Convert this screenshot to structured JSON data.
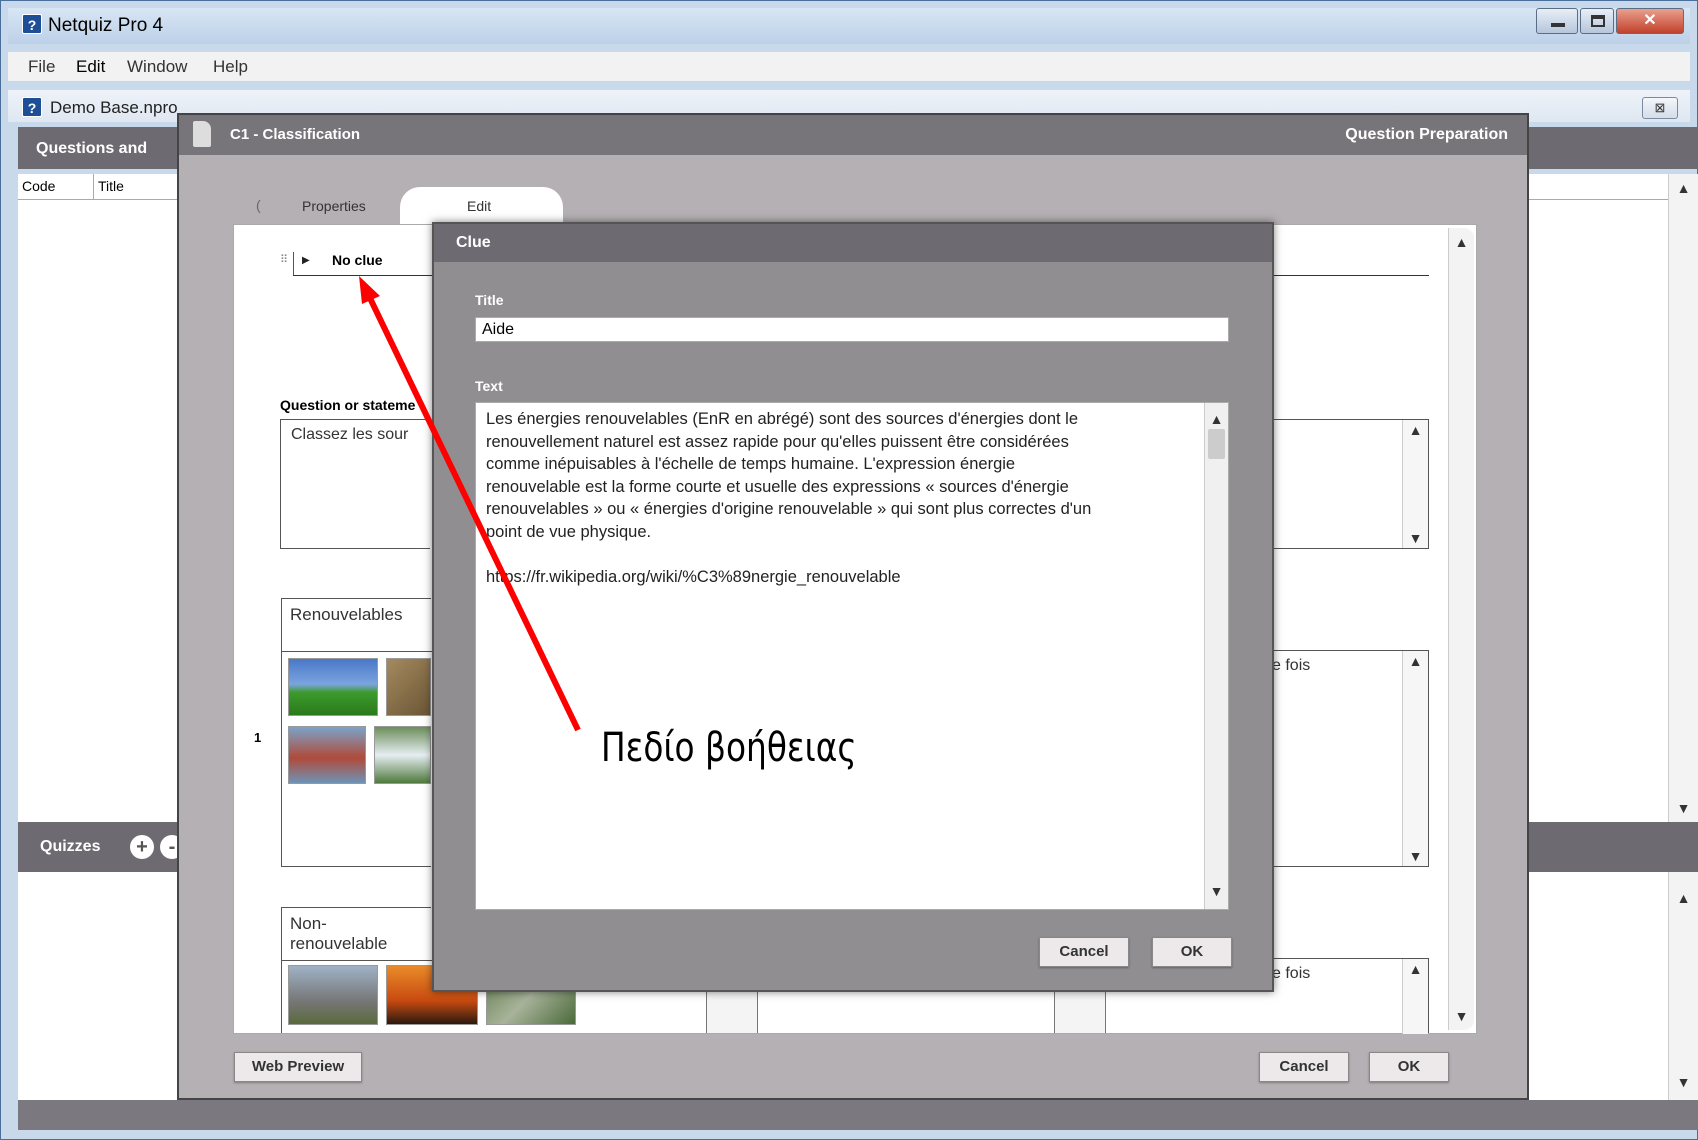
{
  "window": {
    "title": "Netquiz Pro 4",
    "app_icon": "help-icon"
  },
  "menu": [
    "File",
    "Edit",
    "Window",
    "Help"
  ],
  "document": {
    "name": "Demo Base.npro",
    "close_icon": "close-icon"
  },
  "questions_panel": {
    "title": "Questions and",
    "columns": [
      "Code",
      "Title"
    ]
  },
  "quizzes_panel": {
    "title": "Quizzes",
    "add": "+",
    "remove": "-"
  },
  "question_preparation": {
    "question_title": "C1 - Classification",
    "header_right": "Question Preparation",
    "tabs": {
      "prev": "(",
      "properties": "Properties",
      "edit": "Edit"
    },
    "clue_row": {
      "handle": "⠿",
      "arrow": "▶",
      "label": "No clue"
    },
    "question_label": "Question or stateme",
    "question_text": "Classez les sour",
    "row_number": "1",
    "group_renewable": "Renouvelables",
    "group_nonrenewable": "Non-renouvelable",
    "side_text_1": "e fois",
    "side_text_2": "e fois",
    "buttons": {
      "web_preview": "Web Preview",
      "cancel": "Cancel",
      "ok": "OK"
    }
  },
  "clue_dialog": {
    "title": "Clue",
    "title_label": "Title",
    "title_value": "Aide",
    "text_label": "Text",
    "text_value": "Les énergies renouvelables (EnR en abrégé) sont des sources d'énergies dont le\nrenouvellement naturel est assez rapide pour qu'elles puissent être considérées\ncomme inépuisables à l'échelle de temps humaine. L'expression énergie\nrenouvelable est la forme courte et usuelle des expressions « sources d'énergie\nrenouvelables » ou « énergies d'origine renouvelable » qui sont plus correctes d'un\npoint de vue physique.\n\nhttps://fr.wikipedia.org/wiki/%C3%89nergie_renouvelable",
    "cancel": "Cancel",
    "ok": "OK"
  },
  "annotation": {
    "text": "Πεδίο βοήθειας",
    "arrow_color": "#ff0000"
  }
}
